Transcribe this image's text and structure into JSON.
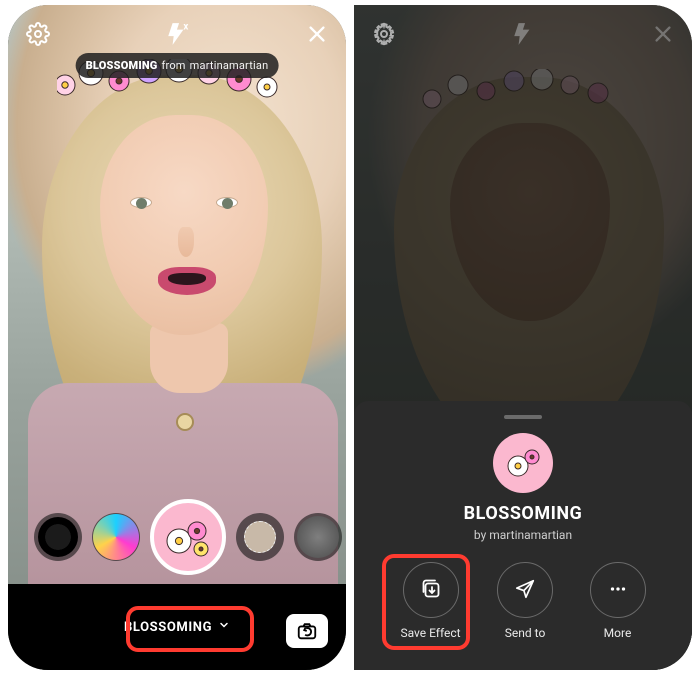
{
  "left": {
    "effect_pill": {
      "name": "BLOSSOMING",
      "from_word": "from",
      "author": "martinamartian"
    },
    "selected_effect": "BLOSSOMING",
    "carousel": [
      "pupil-effect",
      "chrome-face-effect",
      "blossoming-effect",
      "halo-effect",
      "mono-face-effect"
    ]
  },
  "right": {
    "sheet": {
      "title": "BLOSSOMING",
      "by_prefix": "by",
      "author": "martinamartian",
      "actions": {
        "save": "Save Effect",
        "send": "Send to",
        "more": "More"
      }
    }
  }
}
